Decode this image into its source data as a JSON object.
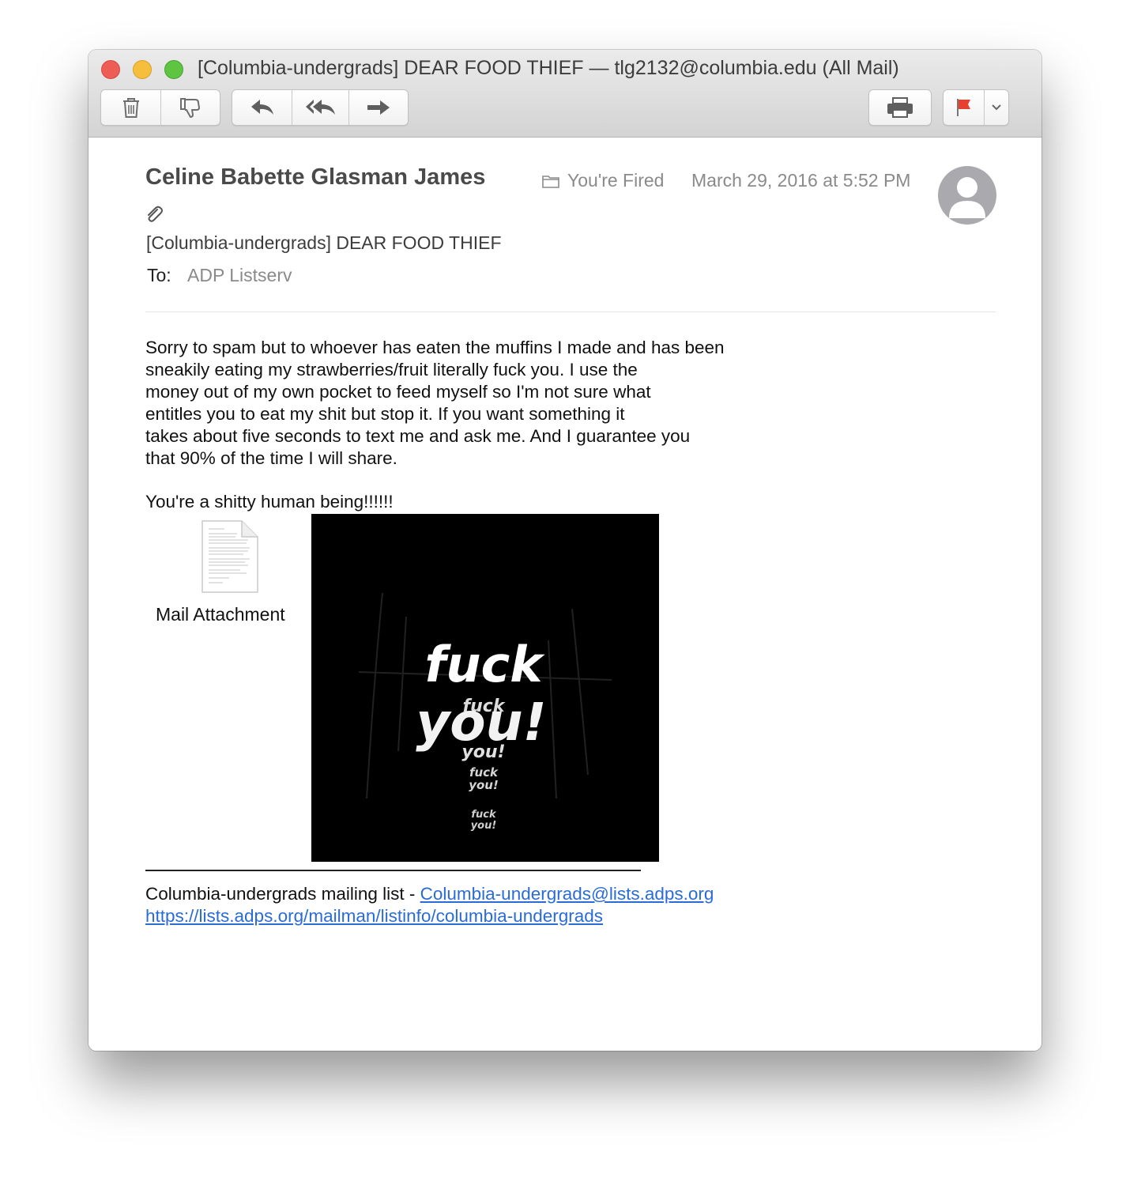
{
  "window": {
    "title": "[Columbia-undergrads] DEAR FOOD THIEF — tlg2132@columbia.edu (All Mail)"
  },
  "toolbar": {
    "icons": [
      "trash-icon",
      "junk-thumbs-down-icon",
      "reply-icon",
      "reply-all-icon",
      "forward-icon",
      "print-icon",
      "flag-icon",
      "chevron-down-icon"
    ],
    "flag_color": "#e8402f"
  },
  "message": {
    "sender": "Celine Babette Glasman James",
    "mailbox": "You're Fired",
    "date": "March 29, 2016 at 5:52 PM",
    "subject": "[Columbia-undergrads] DEAR FOOD THIEF",
    "to_label": "To:",
    "to_value": "ADP Listserv",
    "body_lines": [
      "Sorry to spam but to whoever has eaten the muffins I made and has been",
      "sneakily eating my strawberries/fruit literally fuck you. I use the",
      "money out of my own pocket to feed myself so I'm not sure what",
      "entitles you to eat my shit but stop it. If you want something it",
      "takes about five seconds to text me and ask me. And I guarantee you",
      "that 90% of the time I will share."
    ],
    "closing": "You're a shitty human being!!!!!!",
    "attachment_label": "Mail Attachment",
    "image_text_big_1": "fuck",
    "image_text_big_2": "you!",
    "image_text_small_1": "fuck",
    "image_text_small_2": "you!",
    "image_text_tiny_1": "fuck",
    "image_text_tiny_2": "you!",
    "image_text_mini_1": "fuck",
    "image_text_mini_2": "you!"
  },
  "footer": {
    "list_label": "Columbia-undergrads mailing list  - ",
    "list_email": "Columbia-undergrads@lists.adps.org",
    "list_url": "https://lists.adps.org/mailman/listinfo/columbia-undergrads"
  }
}
